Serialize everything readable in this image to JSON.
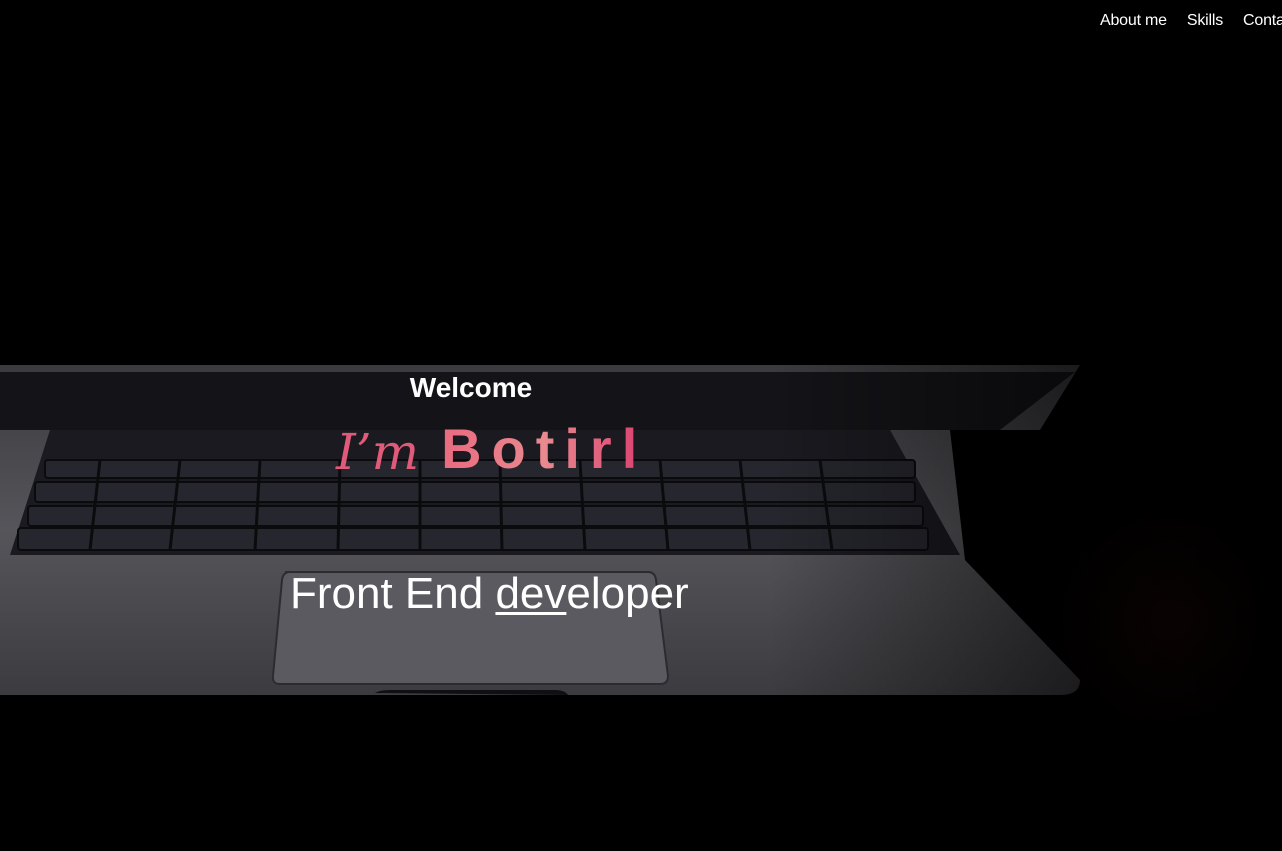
{
  "nav": {
    "items": [
      {
        "label": "About me"
      },
      {
        "label": "Skills"
      },
      {
        "label": "Conta"
      }
    ]
  },
  "hero": {
    "welcome": "Welcome",
    "im": "I’m",
    "name": "Botirl",
    "role_prefix": "Front End ",
    "role_underlined": "dev",
    "role_suffix": "eloper"
  },
  "colors": {
    "background": "#000000",
    "accent_pink": "#e05a7a",
    "text": "#ffffff"
  }
}
